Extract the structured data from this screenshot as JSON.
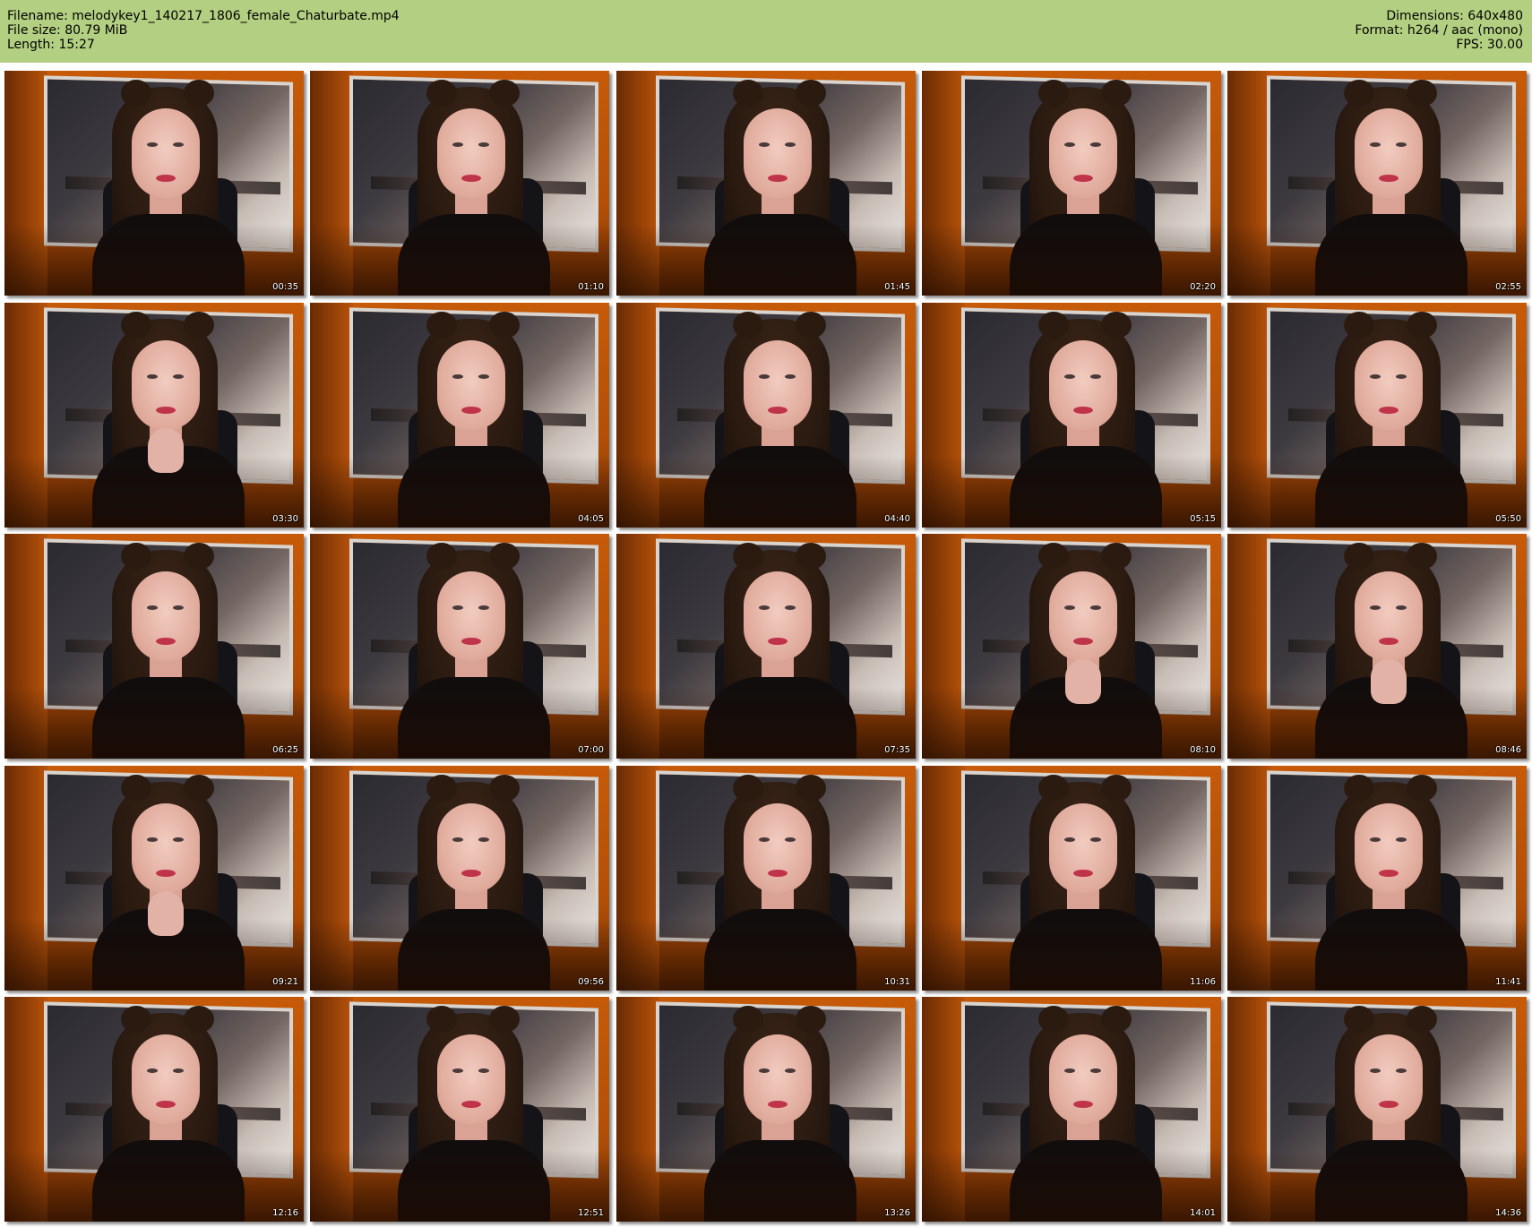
{
  "header": {
    "filename_line": "Filename: melodykey1_140217_1806_female_Chaturbate.mp4",
    "filesize_line": "File size: 80.79 MiB",
    "length_line": "Length: 15:27",
    "dimensions_line": "Dimensions: 640x480",
    "format_line": "Format: h264 / aac (mono)",
    "fps_line": "FPS: 30.00"
  },
  "colors": {
    "header_bg": "#b3cf81",
    "page_bg": "#ffffff"
  },
  "thumbnails": [
    {
      "time": "00:35",
      "hand": false
    },
    {
      "time": "01:10",
      "hand": false
    },
    {
      "time": "01:45",
      "hand": false
    },
    {
      "time": "02:20",
      "hand": false
    },
    {
      "time": "02:55",
      "hand": false
    },
    {
      "time": "03:30",
      "hand": true
    },
    {
      "time": "04:05",
      "hand": false
    },
    {
      "time": "04:40",
      "hand": false
    },
    {
      "time": "05:15",
      "hand": false
    },
    {
      "time": "05:50",
      "hand": false
    },
    {
      "time": "06:25",
      "hand": false
    },
    {
      "time": "07:00",
      "hand": false
    },
    {
      "time": "07:35",
      "hand": false
    },
    {
      "time": "08:10",
      "hand": true
    },
    {
      "time": "08:46",
      "hand": true
    },
    {
      "time": "09:21",
      "hand": true
    },
    {
      "time": "09:56",
      "hand": false
    },
    {
      "time": "10:31",
      "hand": false
    },
    {
      "time": "11:06",
      "hand": false
    },
    {
      "time": "11:41",
      "hand": false
    },
    {
      "time": "12:16",
      "hand": false
    },
    {
      "time": "12:51",
      "hand": false
    },
    {
      "time": "13:26",
      "hand": false
    },
    {
      "time": "14:01",
      "hand": false
    },
    {
      "time": "14:36",
      "hand": false
    }
  ]
}
